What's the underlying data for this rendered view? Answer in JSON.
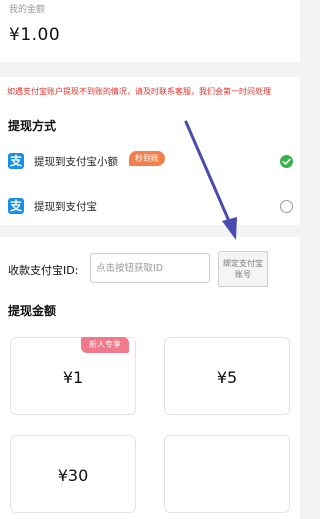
{
  "balance": {
    "label": "我的金额",
    "amount": "¥1.00"
  },
  "notice": "如遇支付宝账户提现不到账的情况，请及时联系客服，我们会第一时间处理",
  "withdraw_method": {
    "title": "提现方式",
    "options": [
      {
        "label": "提现到支付宝小额",
        "badge": "秒到账",
        "selected": true,
        "icon": "alipay-icon"
      },
      {
        "label": "提现到支付宝",
        "selected": false,
        "icon": "alipay-icon"
      }
    ]
  },
  "receive_account": {
    "label": "收款支付宝ID:",
    "placeholder": "点击按钮获取ID",
    "bind_button_label": "绑定支付宝账号"
  },
  "amount_section": {
    "title": "提现金额",
    "options": [
      {
        "value": "¥1",
        "badge": "新人专享"
      },
      {
        "value": "¥5"
      },
      {
        "value": "¥30"
      },
      {
        "value": ""
      }
    ]
  },
  "colors": {
    "accent_red": "#e0312b",
    "alipay_blue": "#1a8fe7",
    "check_green": "#36b24b",
    "badge_orange": "#f2804a",
    "badge_pink": "#f07a8a",
    "annotation_arrow": "#4a4ab0"
  }
}
